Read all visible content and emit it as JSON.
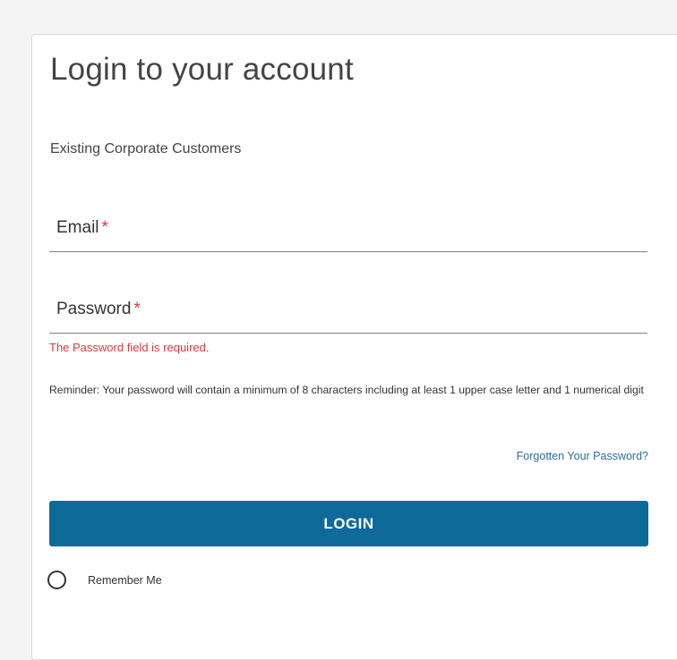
{
  "login": {
    "title": "Login to your account",
    "subtitle": "Existing Corporate Customers",
    "email": {
      "label": "Email",
      "required_marker": "*",
      "value": ""
    },
    "password": {
      "label": "Password",
      "required_marker": "*",
      "value": "",
      "error": "The Password field is required."
    },
    "reminder": "Reminder: Your password will contain a minimum of 8 characters including at least 1 upper case letter and 1 numerical digit",
    "forgot_link": "Forgotten Your Password?",
    "login_button": "LOGIN",
    "remember_me": {
      "label": "Remember Me",
      "checked": false
    }
  },
  "colors": {
    "accent": "#0e6a99",
    "error": "#e0393e",
    "link": "#2a6d9e"
  }
}
